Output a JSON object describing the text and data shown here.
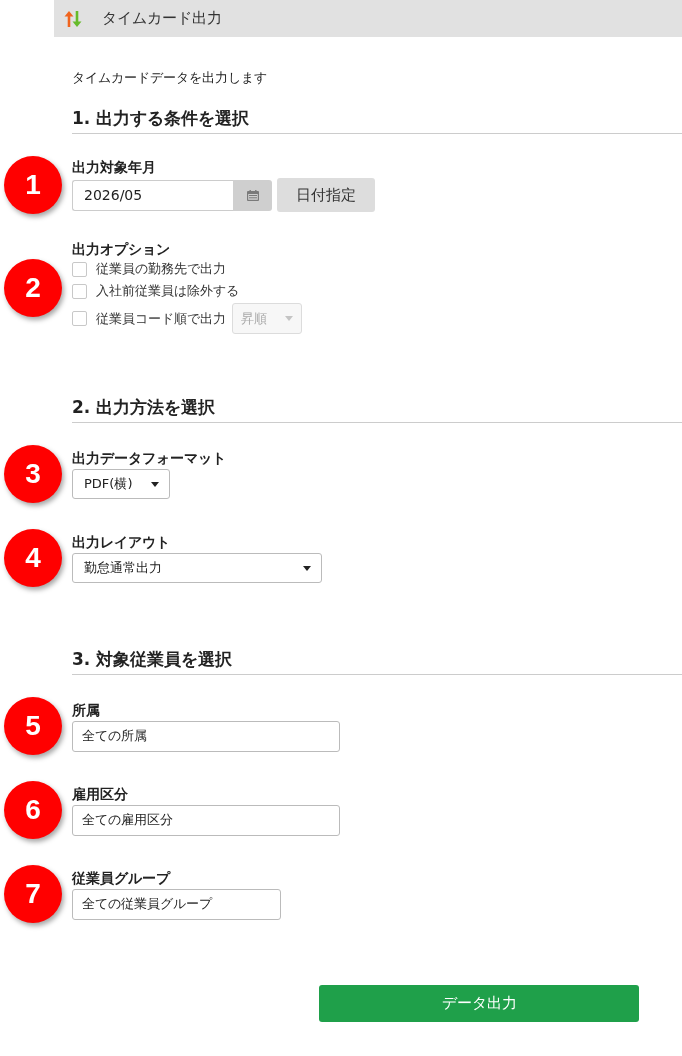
{
  "header": {
    "title": "タイムカード出力"
  },
  "intro": "タイムカードデータを出力します",
  "sections": [
    {
      "heading": "1. 出力する条件を選択",
      "fields": [
        {
          "step": "1",
          "kind": "date",
          "label": "出力対象年月",
          "value": "2026/05",
          "button": "日付指定"
        },
        {
          "step": "2",
          "kind": "options",
          "label": "出力オプション",
          "options": [
            {
              "label": "従業員の勤務先で出力",
              "checked": false
            },
            {
              "label": "入社前従業員は除外する",
              "checked": false
            },
            {
              "label": "従業員コード順で出力",
              "checked": false,
              "order_select": {
                "value": "昇順",
                "disabled": true
              }
            }
          ]
        }
      ]
    },
    {
      "heading": "2. 出力方法を選択",
      "fields": [
        {
          "step": "3",
          "kind": "select",
          "label": "出力データフォーマット",
          "value": "PDF(横)"
        },
        {
          "step": "4",
          "kind": "select",
          "label": "出力レイアウト",
          "value": "勤怠通常出力"
        }
      ]
    },
    {
      "heading": "3. 対象従業員を選択",
      "fields": [
        {
          "step": "5",
          "kind": "text",
          "label": "所属",
          "value": "全ての所属"
        },
        {
          "step": "6",
          "kind": "text",
          "label": "雇用区分",
          "value": "全ての雇用区分"
        },
        {
          "step": "7",
          "kind": "text",
          "label": "従業員グループ",
          "value": "全ての従業員グループ"
        }
      ]
    }
  ],
  "submit_button": "データ出力"
}
